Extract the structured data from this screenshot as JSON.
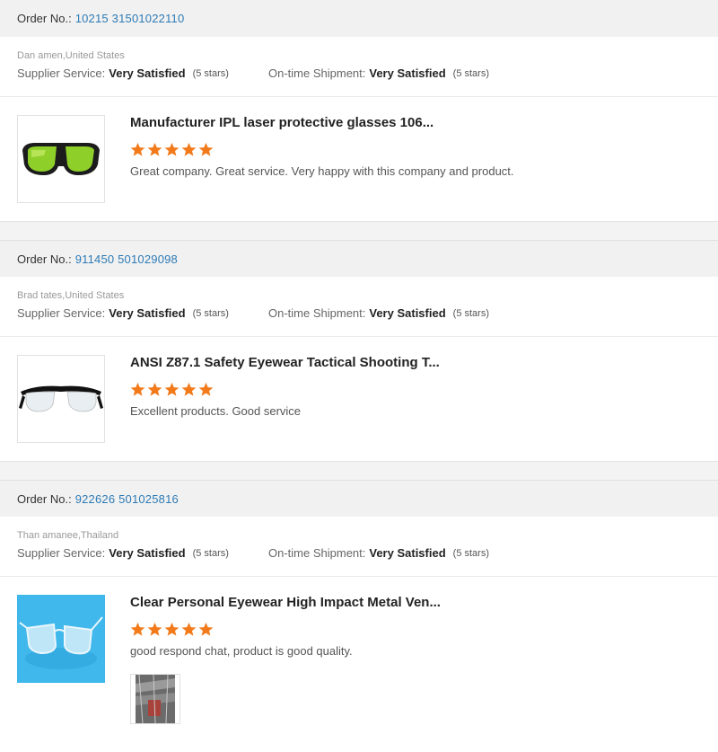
{
  "reviews": [
    {
      "order_label": "Order No.:",
      "order_number": "10215  31501022110",
      "buyer": "Dan  amen,United States",
      "supplier_service_label": "Supplier Service:",
      "supplier_service_value": "Very Satisfied",
      "supplier_service_stars": "(5 stars)",
      "shipment_label": "On-time Shipment:",
      "shipment_value": "Very Satisfied",
      "shipment_stars": "(5 stars)",
      "product_title": "Manufacturer IPL laser protective glasses 106...",
      "rating": 5,
      "comment": "Great company. Great service. Very happy with this company and product.",
      "thumb_icon": "green-laser-glasses-image"
    },
    {
      "order_label": "Order No.:",
      "order_number": "911450  501029098",
      "buyer": "Brad  tates,United States",
      "supplier_service_label": "Supplier Service:",
      "supplier_service_value": "Very Satisfied",
      "supplier_service_stars": "(5 stars)",
      "shipment_label": "On-time Shipment:",
      "shipment_value": "Very Satisfied",
      "shipment_stars": "(5 stars)",
      "product_title": "ANSI Z87.1 Safety Eyewear Tactical Shooting T...",
      "rating": 5,
      "comment": "Excellent products. Good service",
      "thumb_icon": "clear-safety-glasses-image"
    },
    {
      "order_label": "Order No.:",
      "order_number": "922626  501025816",
      "buyer": "Than  amanee,Thailand",
      "supplier_service_label": "Supplier Service:",
      "supplier_service_value": "Very Satisfied",
      "supplier_service_stars": "(5 stars)",
      "shipment_label": "On-time Shipment:",
      "shipment_value": "Very Satisfied",
      "shipment_stars": "(5 stars)",
      "product_title": "Clear Personal Eyewear High Impact Metal Ven...",
      "rating": 5,
      "comment": "good respond chat, product is good quality.",
      "thumb_icon": "metal-frame-eyewear-image",
      "attachment_icon": "attached-photo-image"
    }
  ],
  "colors": {
    "order_number": "#2e7bb6",
    "star": "#f27a1a",
    "bar_bg": "#f1f1f1"
  }
}
